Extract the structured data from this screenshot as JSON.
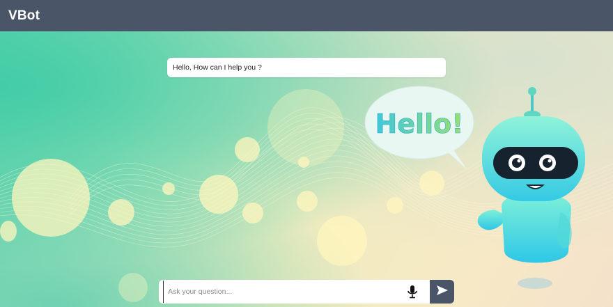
{
  "app": {
    "title": "VBot"
  },
  "chat": {
    "messages": [
      {
        "sender": "bot",
        "text": "Hello, How can I help you ?"
      }
    ]
  },
  "illustration": {
    "bubble_text": "Hello!",
    "name": "robot"
  },
  "composer": {
    "placeholder": "Ask your question...",
    "value": "",
    "mic_icon": "microphone-icon",
    "send_icon": "send-icon"
  },
  "colors": {
    "header": "#4a5568",
    "send_button": "#4a5568",
    "bubble_text": "#3bc8d9",
    "robot_body": "#4fd4e8"
  }
}
